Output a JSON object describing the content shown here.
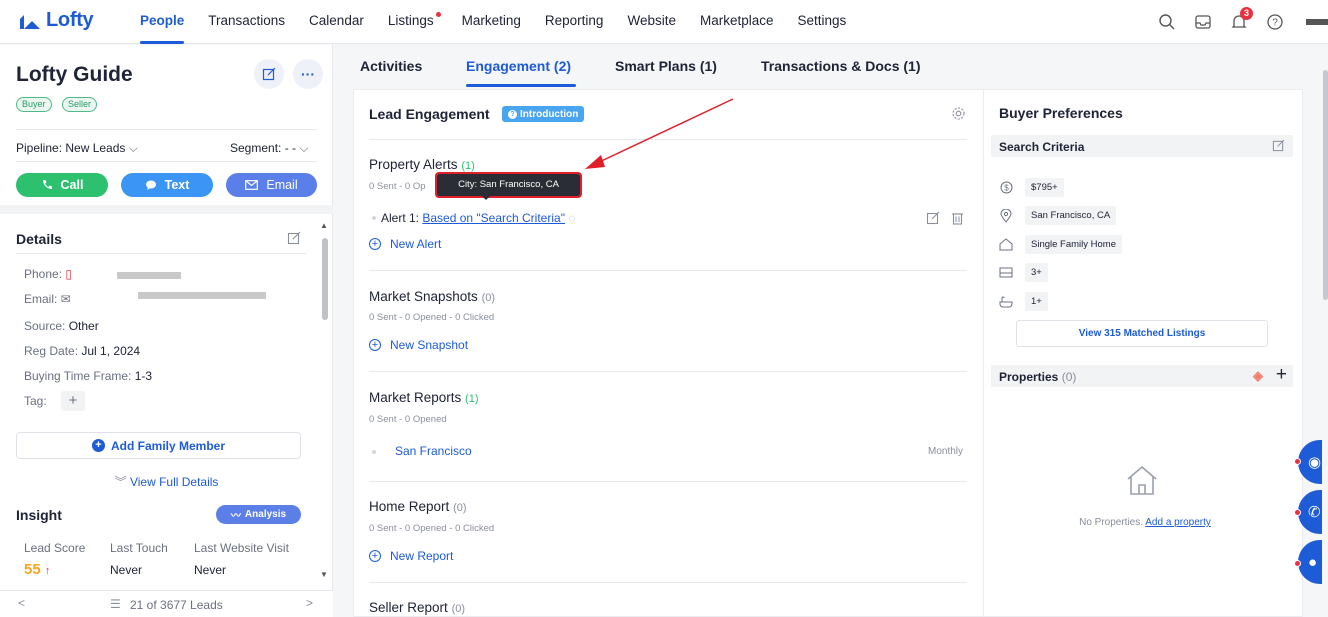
{
  "brand": {
    "name": "Lofty",
    "color": "#1e5bd6"
  },
  "nav": {
    "items": [
      "People",
      "Transactions",
      "Calendar",
      "Listings",
      "Marketing",
      "Reporting",
      "Website",
      "Marketplace",
      "Settings"
    ],
    "active": "People"
  },
  "top_icons": {
    "notification_count": "3"
  },
  "lead": {
    "title": "Lofty Guide",
    "tags": [
      "Buyer",
      "Seller"
    ],
    "pipeline": "Pipeline: New Leads",
    "segment": "Segment: - -",
    "actions": {
      "call": "Call",
      "text": "Text",
      "email": "Email"
    }
  },
  "details": {
    "heading": "Details",
    "phone_label": "Phone:",
    "email_label": "Email:",
    "source_label": "Source:",
    "source_value": "Other",
    "reg_label": "Reg Date:",
    "reg_value": "Jul 1, 2024",
    "buying_label": "Buying Time Frame:",
    "buying_value": "1-3",
    "tag_label": "Tag:",
    "add_family": "Add Family Member",
    "view_full": "View Full Details"
  },
  "insight": {
    "heading": "Insight",
    "analysis": "Analysis",
    "lead_score_label": "Lead Score",
    "lead_score": "55",
    "last_touch_label": "Last Touch",
    "last_touch": "Never",
    "last_visit_label": "Last Website Visit",
    "last_visit": "Never"
  },
  "pager": {
    "text": "21 of 3677 Leads"
  },
  "tabs": [
    "Activities",
    "Engagement (2)",
    "Smart Plans (1)",
    "Transactions & Docs (1)"
  ],
  "engagement": {
    "heading": "Lead Engagement",
    "intro": "Introduction",
    "property_alerts": {
      "title": "Property Alerts",
      "count": "(1)",
      "stats": "0 Sent - 0 Op",
      "alert_prefix": "Alert 1:",
      "alert_link": "Based on \"Search Criteria\"",
      "new": "New Alert"
    },
    "tooltip": "City: San Francisco, CA",
    "market_snapshots": {
      "title": "Market Snapshots",
      "count": "(0)",
      "stats": "0 Sent - 0 Opened - 0 Clicked",
      "new": "New Snapshot"
    },
    "market_reports": {
      "title": "Market Reports",
      "count": "(1)",
      "stats": "0 Sent - 0 Opened",
      "item": "San Francisco",
      "freq": "Monthly"
    },
    "home_report": {
      "title": "Home Report",
      "count": "(0)",
      "stats": "0 Sent - 0 Opened - 0 Clicked",
      "new": "New Report"
    },
    "seller_report": {
      "title": "Seller Report",
      "count": "(0)"
    }
  },
  "buyer_prefs": {
    "heading": "Buyer Preferences",
    "search_criteria": "Search Criteria",
    "price": "$795+",
    "city": "San Francisco, CA",
    "type": "Single Family Home",
    "beds": "3+",
    "baths": "1+",
    "matched": "View 315 Matched Listings",
    "properties": "Properties",
    "properties_count": "(0)",
    "no_properties": "No Properties.",
    "add_property": "Add a property"
  }
}
